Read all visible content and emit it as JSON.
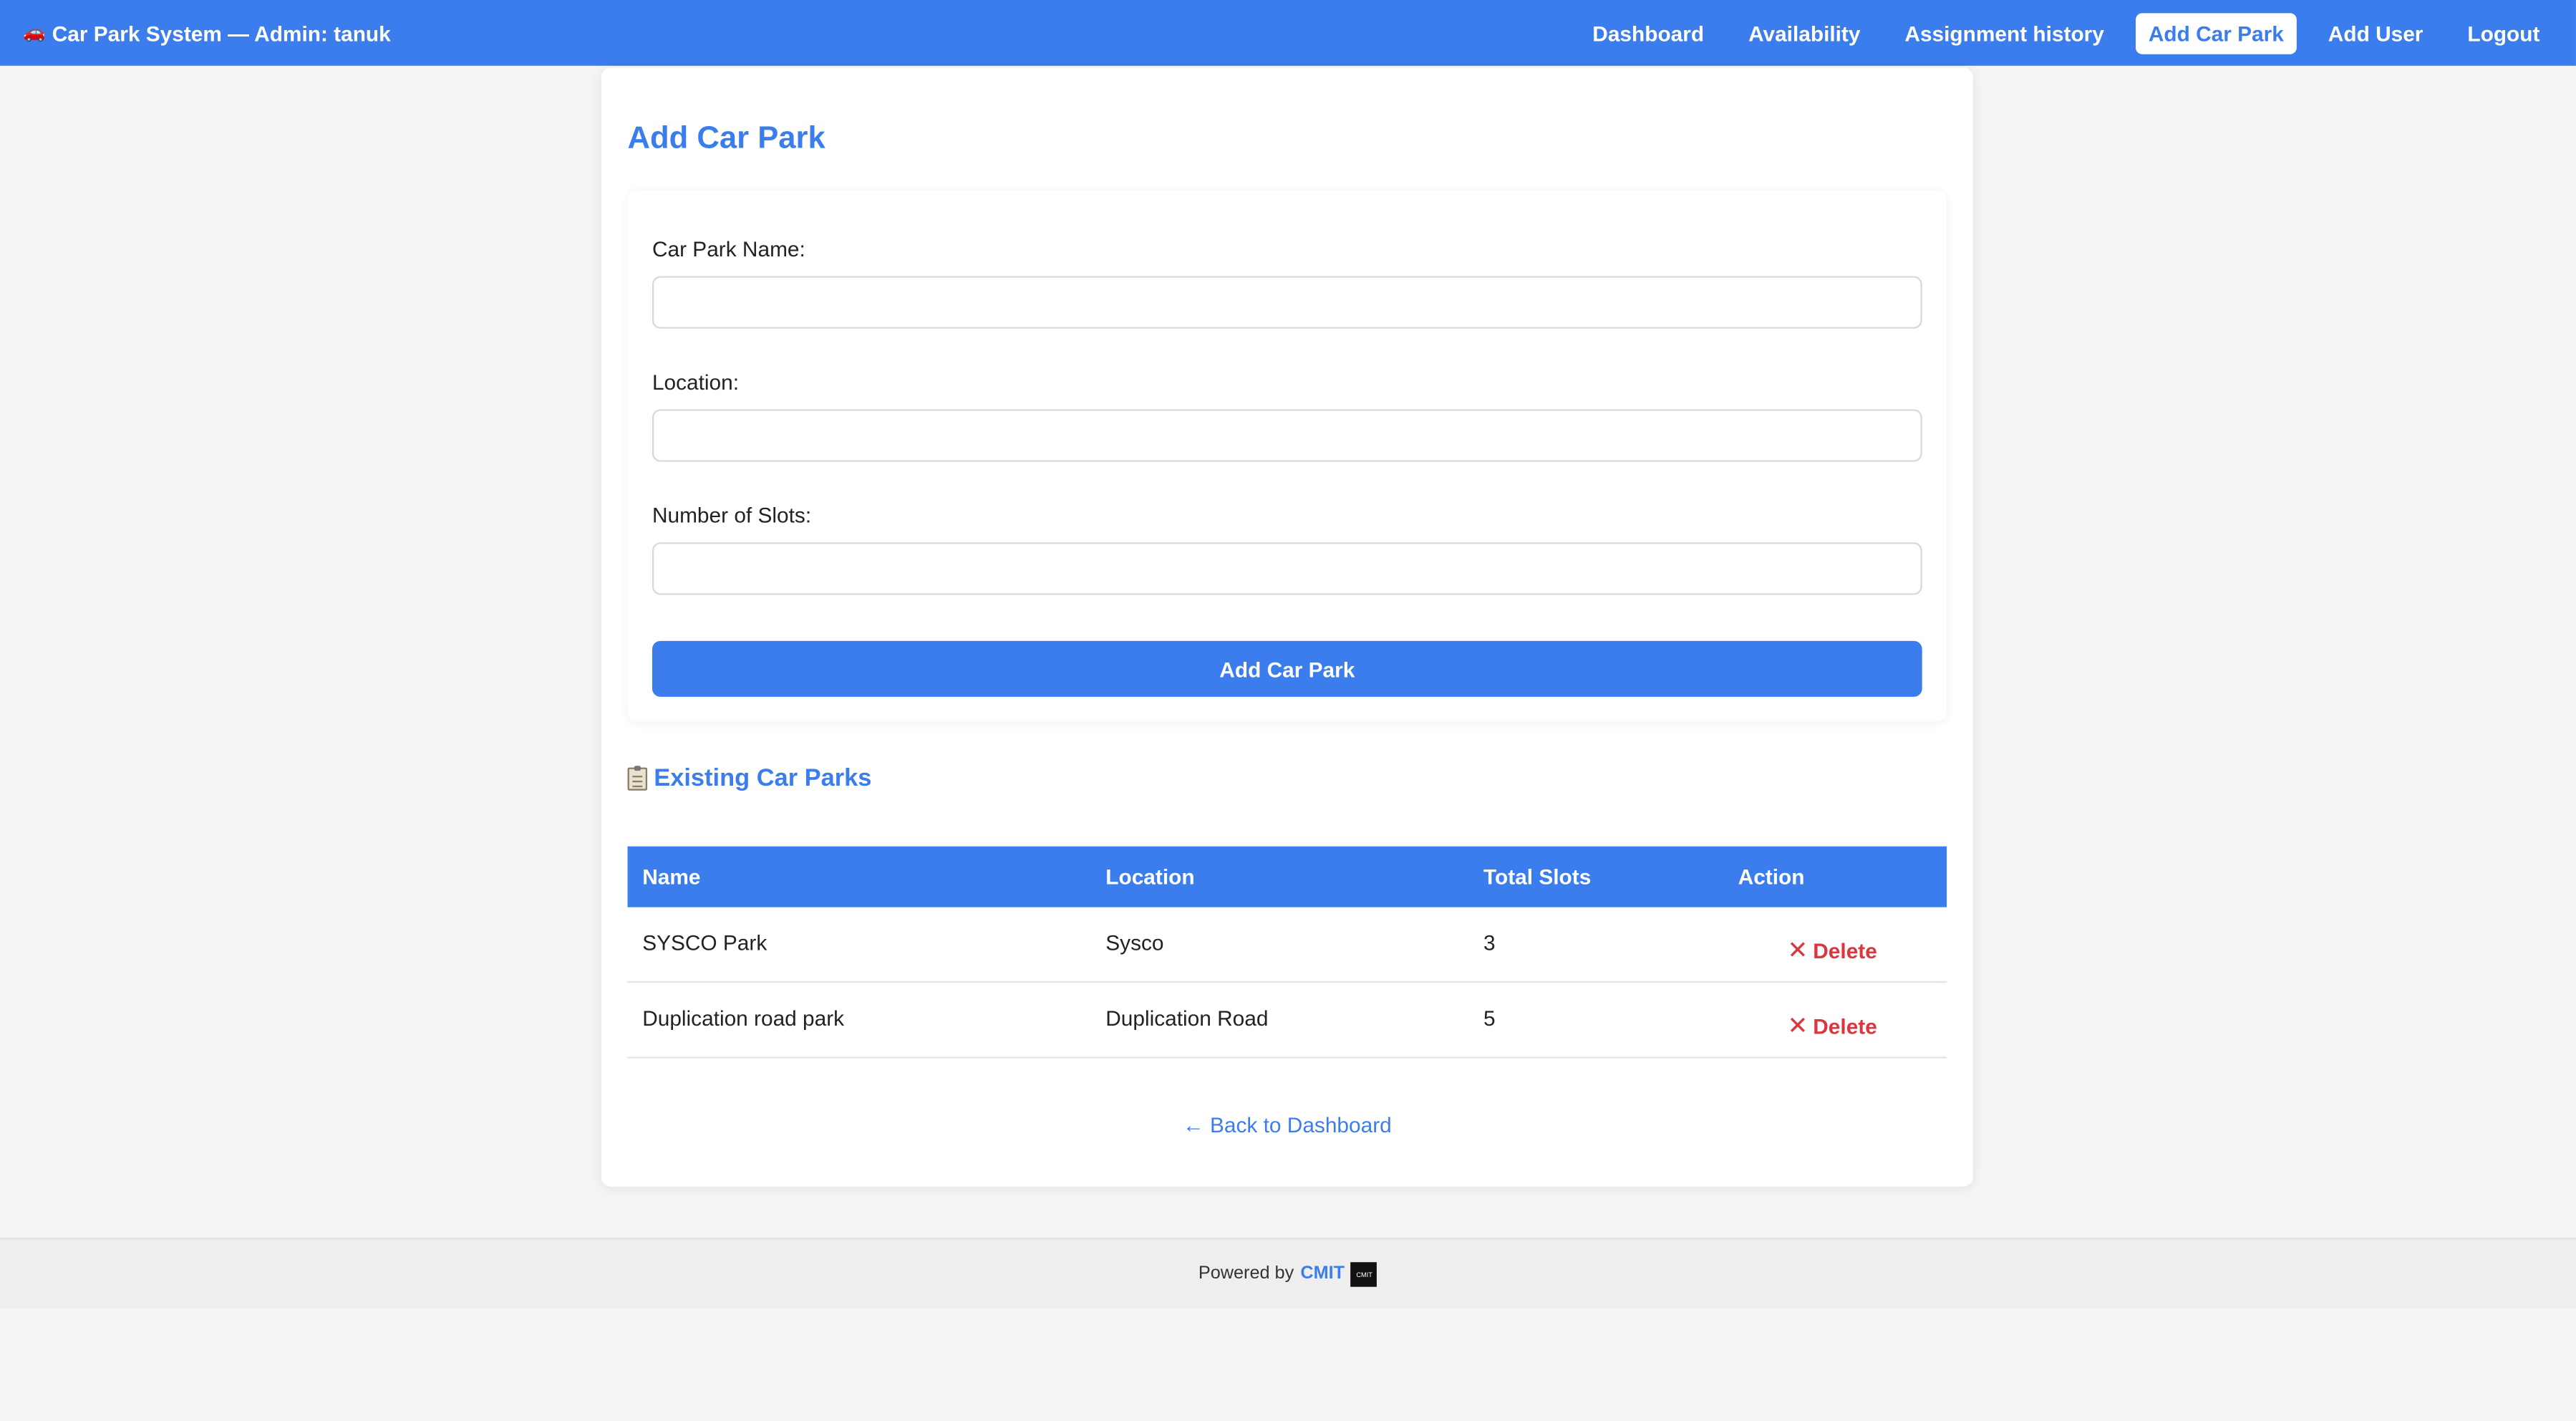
{
  "navbar": {
    "brand_icon": "🚗",
    "title": "Car Park System — Admin: tanuk",
    "links": [
      {
        "label": "Dashboard"
      },
      {
        "label": "Availability"
      },
      {
        "label": "Assignment history"
      },
      {
        "label": "Add Car Park"
      },
      {
        "label": "Add User"
      },
      {
        "label": "Logout"
      }
    ],
    "active_link": "Add Car Park"
  },
  "page": {
    "title": "Add Car Park"
  },
  "form": {
    "name_label": "Car Park Name:",
    "name_value": "",
    "location_label": "Location:",
    "location_value": "",
    "slots_label": "Number of Slots:",
    "slots_value": "",
    "submit_label": "Add Car Park"
  },
  "existing": {
    "icon": "clipboard-icon",
    "title": "Existing Car Parks",
    "columns": [
      "Name",
      "Location",
      "Total Slots",
      "Action"
    ],
    "rows": [
      {
        "name": "SYSCO Park",
        "location": "Sysco",
        "slots": "3",
        "action": "Delete"
      },
      {
        "name": "Duplication road park",
        "location": "Duplication Road",
        "slots": "5",
        "action": "Delete"
      }
    ]
  },
  "back_link": "← Back to Dashboard",
  "footer": {
    "powered_by": "Powered by",
    "brand": "CMIT",
    "logo_text": "CMIT"
  },
  "colors": {
    "primary": "#3b7ded",
    "danger": "#d9363e",
    "background": "#f4f5f7"
  }
}
